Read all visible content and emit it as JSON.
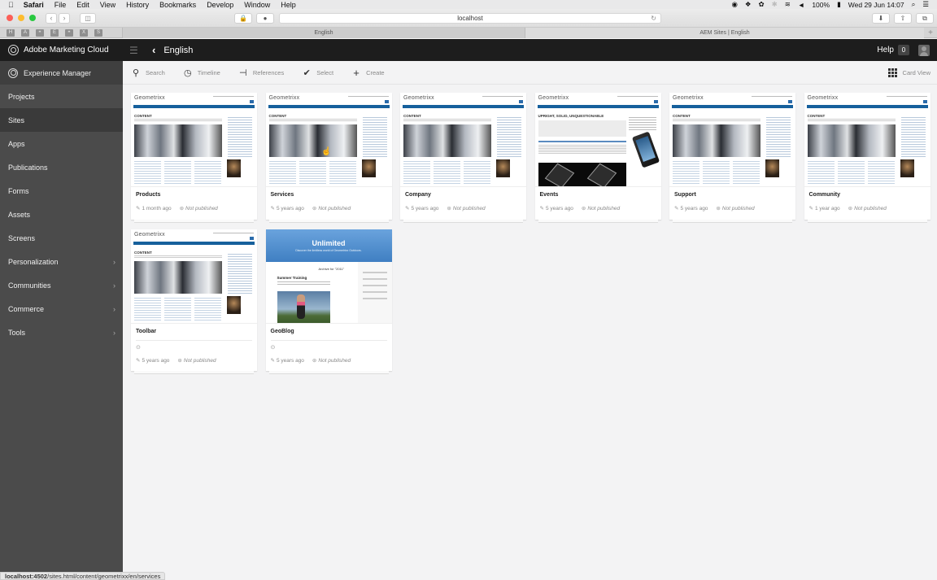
{
  "os_menubar": {
    "items": [
      "Safari",
      "File",
      "Edit",
      "View",
      "History",
      "Bookmarks",
      "Develop",
      "Window",
      "Help"
    ],
    "battery": "100%",
    "clock": "Wed 29 Jun  14:07"
  },
  "browser": {
    "address": "localhost",
    "favorites": [
      "H",
      "A",
      "ꟸ",
      "E",
      "ꟸ",
      "X",
      "S"
    ],
    "tabs": [
      {
        "label": "English",
        "active": true
      },
      {
        "label": "AEM Sites | English",
        "active": false
      }
    ],
    "status_url_host": "localhost:4502",
    "status_url_path": "/sites.html/content/geometrixx/en/services"
  },
  "topnav": {
    "brand": "Adobe Marketing Cloud",
    "page_title": "English",
    "help_label": "Help",
    "notification_count": "0"
  },
  "sidebar": {
    "header": "Experience Manager",
    "items": [
      {
        "label": "Projects",
        "has_children": false,
        "active": false
      },
      {
        "label": "Sites",
        "has_children": false,
        "active": true
      },
      {
        "label": "Apps",
        "has_children": false,
        "active": false
      },
      {
        "label": "Publications",
        "has_children": false,
        "active": false
      },
      {
        "label": "Forms",
        "has_children": false,
        "active": false
      },
      {
        "label": "Assets",
        "has_children": false,
        "active": false
      },
      {
        "label": "Screens",
        "has_children": false,
        "active": false
      },
      {
        "label": "Personalization",
        "has_children": true,
        "active": false
      },
      {
        "label": "Communities",
        "has_children": true,
        "active": false
      },
      {
        "label": "Commerce",
        "has_children": true,
        "active": false
      },
      {
        "label": "Tools",
        "has_children": true,
        "active": false
      }
    ]
  },
  "actionbar": {
    "search": "Search",
    "timeline": "Timeline",
    "references": "References",
    "select": "Select",
    "create": "Create",
    "view": "Card View"
  },
  "thumb_text": {
    "logo": "Geometrixx",
    "content_heading": "CONTENT",
    "events_heading": "UPRIGHT, SOLID, UNQUESTIONABLE",
    "blog_title": "Unlimited",
    "blog_subtitle": "Discover the limitless world of Geometrixx Outdoors.",
    "blog_archive": "Archive for \"2011\"",
    "blog_post": "Summer Training"
  },
  "cards": [
    {
      "title": "Products",
      "modified": "1 month ago",
      "status": "Not published",
      "thumb": "geometrixx"
    },
    {
      "title": "Services",
      "modified": "5 years ago",
      "status": "Not published",
      "thumb": "geometrixx"
    },
    {
      "title": "Company",
      "modified": "5 years ago",
      "status": "Not published",
      "thumb": "geometrixx"
    },
    {
      "title": "Events",
      "modified": "5 years ago",
      "status": "Not published",
      "thumb": "events"
    },
    {
      "title": "Support",
      "modified": "5 years ago",
      "status": "Not published",
      "thumb": "geometrixx"
    },
    {
      "title": "Community",
      "modified": "1 year ago",
      "status": "Not published",
      "thumb": "geometrixx"
    },
    {
      "title": "Toolbar",
      "modified": "5 years ago",
      "status": "Not published",
      "thumb": "geometrixx",
      "live_copy": true
    },
    {
      "title": "GeoBlog",
      "modified": "5 years ago",
      "status": "Not published",
      "thumb": "blog",
      "live_copy": true
    }
  ]
}
